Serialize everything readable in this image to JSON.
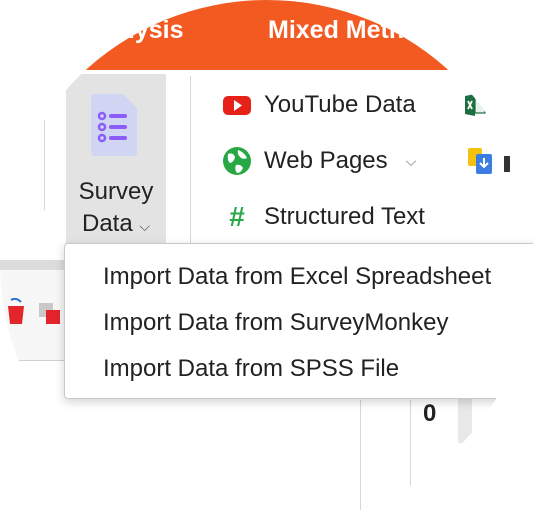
{
  "ribbon_tabs": [
    "alysis",
    "Mixed Meth"
  ],
  "survey": {
    "label_line1": "Survey",
    "label_line2": "Data"
  },
  "sources": [
    {
      "label": "YouTube Data",
      "icon": "youtube-icon"
    },
    {
      "label": "Web Pages",
      "icon": "globe-icon"
    },
    {
      "label": "Structured Text",
      "icon": "hash-icon"
    }
  ],
  "menu": {
    "items": [
      "Import Data from Excel Spreadsheet",
      "Import Data from SurveyMonkey",
      "Import Data from SPSS File"
    ]
  },
  "grid": {
    "cell_value": "0"
  },
  "colors": {
    "ribbon_accent": "#f25a22",
    "survey_icon": "#8b5cf6",
    "hash": "#2aa84a",
    "youtube": "#e62117"
  }
}
